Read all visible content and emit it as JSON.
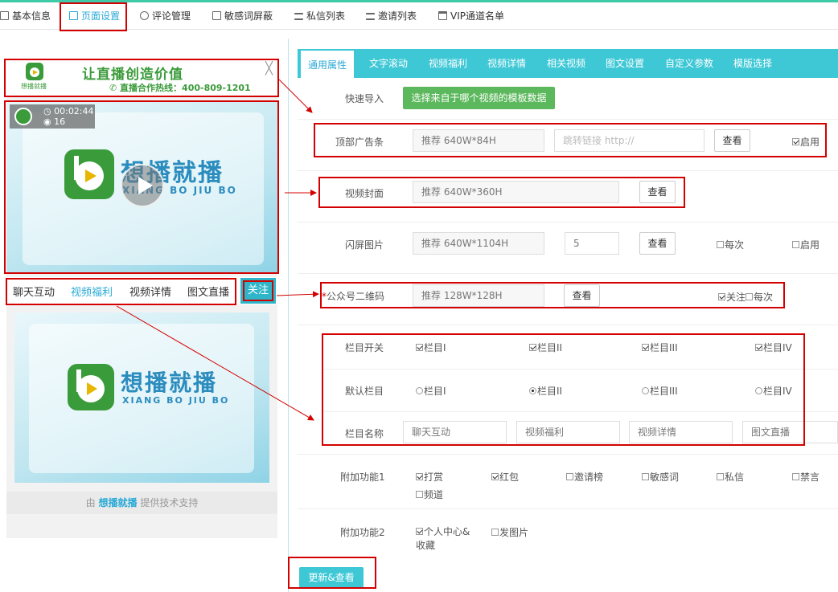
{
  "nav": {
    "tabs": [
      {
        "label": "基本信息"
      },
      {
        "label": "页面设置"
      },
      {
        "label": "评论管理"
      },
      {
        "label": "敏感词屏蔽"
      },
      {
        "label": "私信列表"
      },
      {
        "label": "邀请列表"
      },
      {
        "label": "VIP通道名单"
      }
    ],
    "active": "页面设置"
  },
  "preview": {
    "ad": {
      "logo_text": "想播就播",
      "title": "让直播创造价值",
      "phone": "直播合作热线：400-809-1201",
      "close": "╳"
    },
    "video": {
      "duration": "00:02:44",
      "views": "16",
      "brand": "想播就播",
      "brand_en": "XIANG BO JIU BO"
    },
    "tabs": [
      "聊天互动",
      "视频福利",
      "视频详情",
      "图文直播"
    ],
    "active_tab": "视频福利",
    "follow_label": "关注",
    "content": {
      "brand": "想播就播",
      "brand_en": "XIANG BO JIU BO"
    },
    "footer": {
      "prefix": "由 ",
      "brand": "想播就播",
      "suffix": " 提供技术支持"
    }
  },
  "settings": {
    "tabs": [
      "通用属性",
      "文字滚动",
      "视频福利",
      "视频详情",
      "相关视频",
      "图文设置",
      "自定义参数",
      "模版选择"
    ],
    "active_tab": "通用属性",
    "quick_import": {
      "label": "快速导入",
      "button": "选择来自于哪个视频的模板数据"
    },
    "top_ad": {
      "label": "顶部广告条",
      "value": "推荐 640W*84H",
      "link_placeholder": "跳转链接 http://",
      "view": "查看",
      "enable": "启用",
      "enabled": true
    },
    "video_cover": {
      "label": "视频封面",
      "value": "推荐 640W*360H",
      "view": "查看"
    },
    "splash": {
      "label": "闪屏图片",
      "value": "推荐 640W*1104H",
      "seconds": "5",
      "view": "查看",
      "every_time": "每次",
      "enable": "启用"
    },
    "qrcode": {
      "required_mark": "*",
      "label": "公众号二维码",
      "value": "推荐 128W*128H",
      "view": "查看",
      "follow": "关注",
      "every_time": "每次"
    },
    "column_switch": {
      "label": "栏目开关",
      "options": [
        "栏目I",
        "栏目II",
        "栏目III",
        "栏目IV"
      ],
      "checked": [
        true,
        true,
        true,
        true
      ]
    },
    "default_column": {
      "label": "默认栏目",
      "options": [
        "栏目I",
        "栏目II",
        "栏目III",
        "栏目IV"
      ],
      "selected": 1
    },
    "column_names": {
      "label": "栏目名称",
      "values": [
        "聊天互动",
        "视频福利",
        "视频详情",
        "图文直播"
      ]
    },
    "extra1": {
      "label": "附加功能1",
      "options": [
        "打赏",
        "红包",
        "邀请榜",
        "敏感词",
        "私信",
        "禁言",
        "频道"
      ],
      "checked": [
        true,
        true,
        false,
        false,
        false,
        false,
        false
      ]
    },
    "extra2": {
      "label": "附加功能2",
      "options": [
        "个人中心&收藏",
        "发图片"
      ],
      "checked": [
        true,
        false
      ]
    },
    "submit": "更新&查看"
  },
  "colors": {
    "accent": "#3ec8d6",
    "highlight_box": "#d40000",
    "green": "#5cb85c",
    "link": "#2aa9d6"
  }
}
